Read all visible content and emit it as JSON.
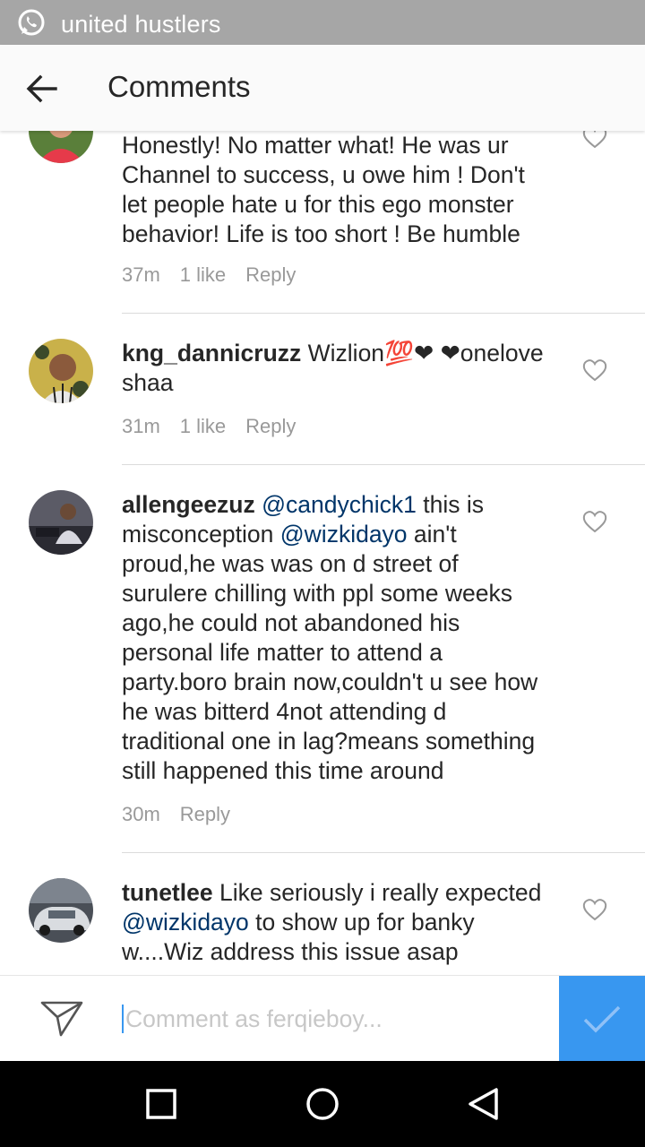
{
  "statusbar": {
    "title": "united hustlers",
    "icon": "whatsapp-icon"
  },
  "appbar": {
    "title": "Comments",
    "back_icon": "arrow-left-icon"
  },
  "comments": [
    {
      "lines": [
        "Honestly! No matter what! He was ur",
        "Channel to success, u owe him ! Don't",
        "let people hate u for this ego monster",
        "behavior! Life is too short ! Be humble"
      ],
      "time": "37m",
      "likes": "1 like",
      "reply": "Reply"
    },
    {
      "user": "kng_dannicruzz",
      "text_line1": "Wizlion💯❤ ❤onelove",
      "text_line2": "shaa",
      "time": "31m",
      "likes": "1 like",
      "reply": "Reply"
    },
    {
      "user": "allengeezuz",
      "mention1": "@candychick1",
      "after_mention1": " this is",
      "line2_before": "misconception ",
      "mention2": "@wizkidayo",
      "line2_after": " ain't",
      "lines_rest": [
        "proud,he was was on d street of",
        "surulere chilling with ppl some weeks",
        "ago,he could not abandoned his",
        "personal life matter to attend a",
        "party.boro brain now,couldn't u see how",
        "he was bitterd 4not attending d",
        "traditional one in lag?means something",
        "still happened this time around"
      ],
      "time": "30m",
      "reply": "Reply"
    },
    {
      "user": "tunetlee",
      "line1_rest": " Like seriously i really expected",
      "mention": "@wizkidayo",
      "line2_rest": "  to show up for banky",
      "line3": "w....Wiz address this issue asap"
    }
  ],
  "composer": {
    "placeholder": "Comment as ferqieboy...",
    "send_icon": "paper-plane-icon",
    "post_icon": "checkmark-icon"
  },
  "colors": {
    "accent": "#3897f0",
    "mention": "#003569",
    "meta": "#999999",
    "statusbar": "#a6a6a6"
  }
}
